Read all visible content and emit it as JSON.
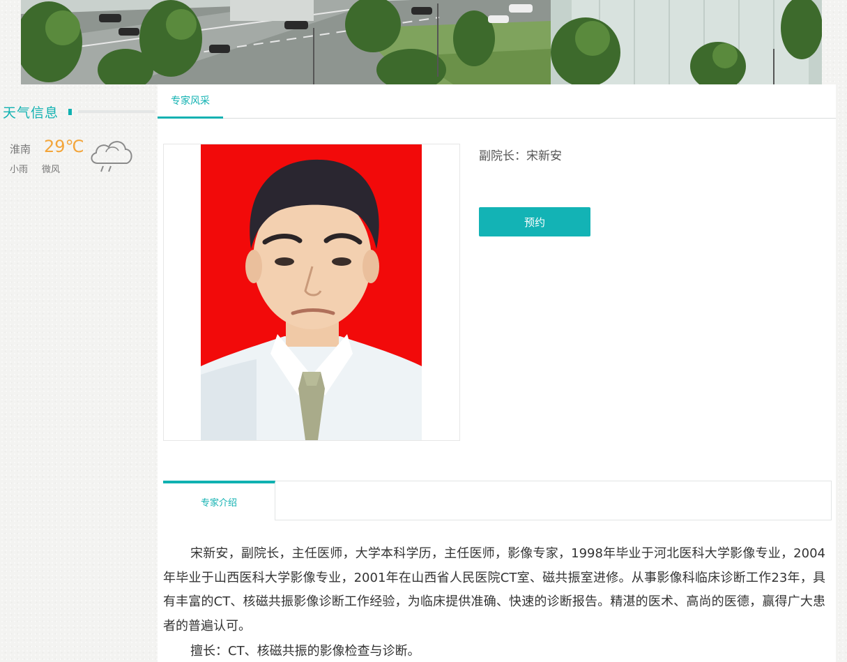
{
  "sidebar": {
    "weather_title": "天气信息",
    "city": "淮南",
    "temperature": "29℃",
    "condition": "小雨",
    "wind": "微风",
    "weather_icon": "cloud-rain-icon"
  },
  "tabs": {
    "top_tab": "专家风采",
    "intro_tab": "专家介绍"
  },
  "expert": {
    "title": "副院长：宋新安",
    "book_label": "预约",
    "intro": "宋新安，副院长，主任医师，大学本科学历，主任医师，影像专家，1998年毕业于河北医科大学影像专业，2004年毕业于山西医科大学影像专业，2001年在山西省人民医院CT室、磁共振室进修。从事影像科临床诊断工作23年，具有丰富的CT、核磁共振影像诊断工作经验，为临床提供准确、快速的诊断报告。精湛的医术、高尚的医德，赢得广大患者的普遍认可。",
    "skill": "擅长：CT、核磁共振的影像检查与诊断。"
  },
  "colors": {
    "accent": "#10b1b1",
    "temperature": "#f3a53a",
    "photo_background": "#f20a0a"
  }
}
